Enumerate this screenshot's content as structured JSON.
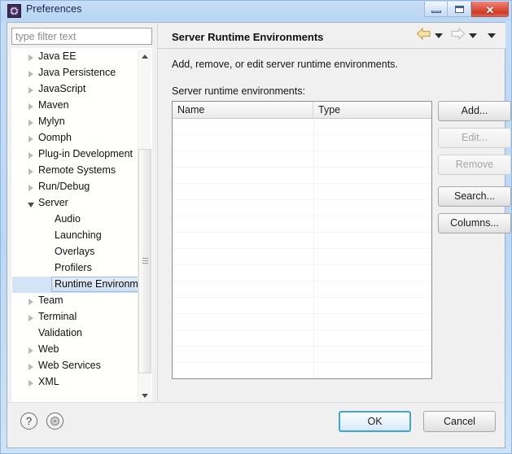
{
  "window": {
    "title": "Preferences",
    "icon": "gear-icon",
    "buttons": {
      "minimize": "minimize-icon",
      "maximize": "maximize-icon",
      "close": "✕"
    }
  },
  "filter": {
    "placeholder": "type filter text",
    "value": ""
  },
  "tree": {
    "items": [
      {
        "label": "Java EE",
        "level": 1,
        "state": "collapsed",
        "selected": false
      },
      {
        "label": "Java Persistence",
        "level": 1,
        "state": "collapsed",
        "selected": false
      },
      {
        "label": "JavaScript",
        "level": 1,
        "state": "collapsed",
        "selected": false
      },
      {
        "label": "Maven",
        "level": 1,
        "state": "collapsed",
        "selected": false
      },
      {
        "label": "Mylyn",
        "level": 1,
        "state": "collapsed",
        "selected": false
      },
      {
        "label": "Oomph",
        "level": 1,
        "state": "collapsed",
        "selected": false
      },
      {
        "label": "Plug-in Development",
        "level": 1,
        "state": "collapsed",
        "selected": false
      },
      {
        "label": "Remote Systems",
        "level": 1,
        "state": "collapsed",
        "selected": false
      },
      {
        "label": "Run/Debug",
        "level": 1,
        "state": "collapsed",
        "selected": false
      },
      {
        "label": "Server",
        "level": 1,
        "state": "expanded",
        "selected": false
      },
      {
        "label": "Audio",
        "level": 2,
        "state": "leaf",
        "selected": false
      },
      {
        "label": "Launching",
        "level": 2,
        "state": "leaf",
        "selected": false
      },
      {
        "label": "Overlays",
        "level": 2,
        "state": "leaf",
        "selected": false
      },
      {
        "label": "Profilers",
        "level": 2,
        "state": "leaf",
        "selected": false
      },
      {
        "label": "Runtime Environm",
        "level": 2,
        "state": "leaf",
        "selected": true
      },
      {
        "label": "Team",
        "level": 1,
        "state": "collapsed",
        "selected": false
      },
      {
        "label": "Terminal",
        "level": 1,
        "state": "collapsed",
        "selected": false
      },
      {
        "label": "Validation",
        "level": 1,
        "state": "leaf",
        "selected": false
      },
      {
        "label": "Web",
        "level": 1,
        "state": "collapsed",
        "selected": false
      },
      {
        "label": "Web Services",
        "level": 1,
        "state": "collapsed",
        "selected": false
      },
      {
        "label": "XML",
        "level": 1,
        "state": "collapsed",
        "selected": false
      }
    ]
  },
  "pane": {
    "title": "Server Runtime Environments",
    "description": "Add, remove, or edit server runtime environments.",
    "list_label": "Server runtime environments:",
    "nav": {
      "back_icon": "back-arrow-icon",
      "back_color": "#f0dba0",
      "back_dropdown_icon": "chevron-down-icon",
      "forward_icon": "forward-arrow-icon",
      "forward_color": "#e8e8e8",
      "forward_dropdown_icon": "chevron-down-icon",
      "menu_dropdown_icon": "chevron-down-icon"
    }
  },
  "table": {
    "columns": [
      "Name",
      "Type"
    ],
    "rows": [],
    "empty_row_count": 16
  },
  "side_buttons": [
    {
      "label": "Add...",
      "enabled": true
    },
    {
      "label": "Edit...",
      "enabled": false
    },
    {
      "label": "Remove",
      "enabled": false
    },
    {
      "label": "Search...",
      "enabled": true
    },
    {
      "label": "Columns...",
      "enabled": true
    }
  ],
  "bottom": {
    "help_icon": "question-mark-icon",
    "help_glyph": "?",
    "about_icon": "about-circle-icon",
    "ok_label": "OK",
    "cancel_label": "Cancel"
  },
  "colors": {
    "titlebar": "#bdd8f4",
    "dialog_bg": "#f0f0f0",
    "selection": "#cfe0f3",
    "focus_ring": "#3fa4d6",
    "close_button": "#cf3b27"
  }
}
